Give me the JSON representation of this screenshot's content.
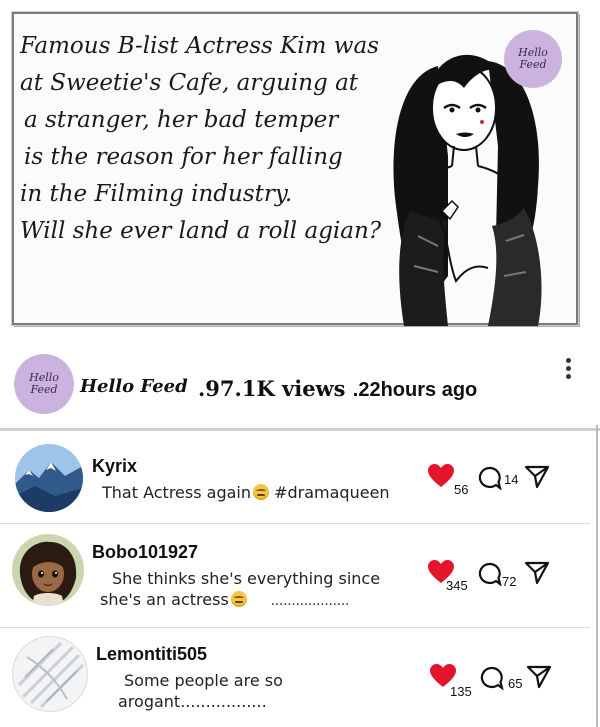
{
  "post": {
    "lines": [
      "Famous B-list Actress Kim was",
      "at Sweetie's Cafe, arguing at",
      "a stranger, her bad temper",
      "is the reason for her falling",
      "in the Filming industry.",
      "Will she ever land a roll agian?"
    ],
    "badge_line1": "Hello",
    "badge_line2": "Feed"
  },
  "channel": {
    "badge_line1": "Hello",
    "badge_line2": "Feed",
    "name": "Hello Feed",
    "views": ".97.1K views",
    "ago": ".22hours ago"
  },
  "comments": [
    {
      "user": "Kyrix",
      "text_line1_a": "That Actress again",
      "text_line1_b": " #dramaqueen",
      "likes": "56",
      "replies": "14"
    },
    {
      "user": "Bobo101927",
      "text_line1": "She thinks she's everything since",
      "text_line2_a": "she's an actress",
      "text_line2_b": "...................",
      "likes": "345",
      "replies": "72"
    },
    {
      "user": "Lemontiti505",
      "text_line1": "Some people are so",
      "text_line2": "arogant.................",
      "likes": "135",
      "replies": "65"
    }
  ],
  "colors": {
    "heart": "#e3142b",
    "badge": "#cbb3de",
    "accent_dark": "#111111"
  },
  "icons": {
    "like": "heart-icon",
    "reply": "comment-bubble-icon",
    "share": "send-icon",
    "menu": "more-vertical-icon"
  }
}
